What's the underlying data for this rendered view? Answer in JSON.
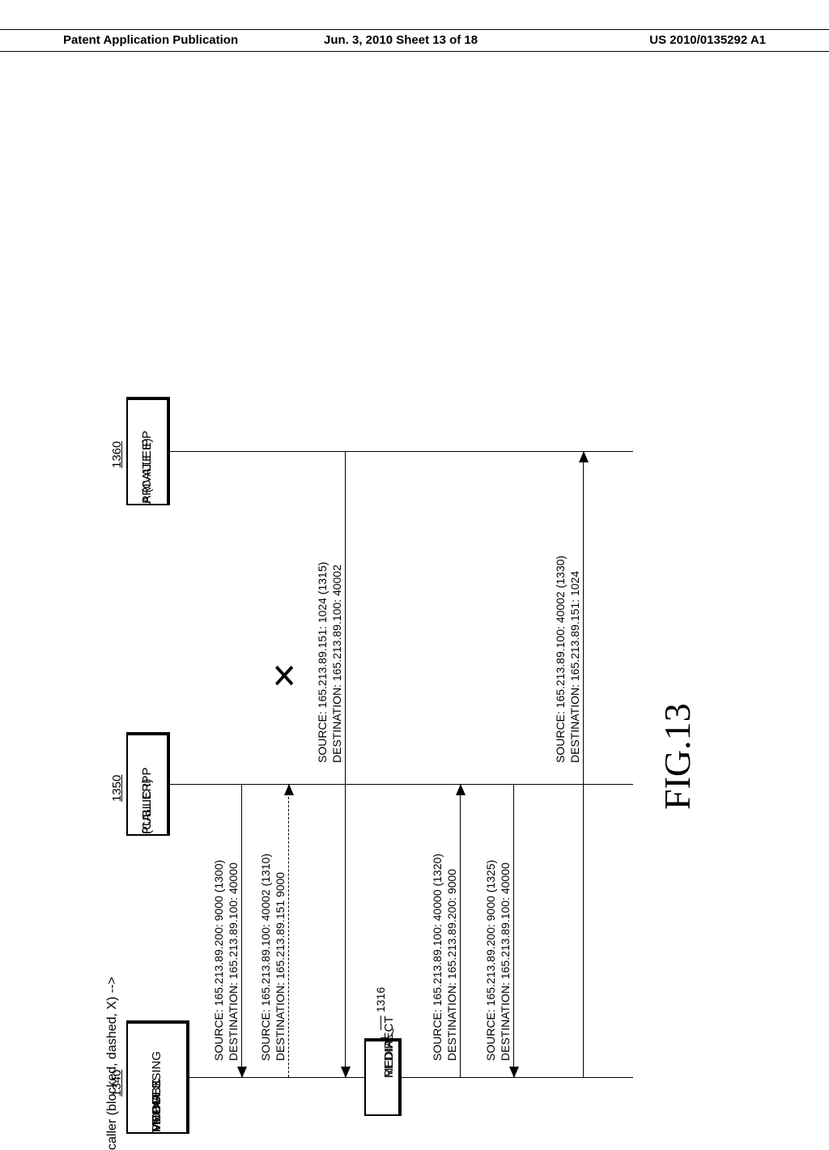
{
  "header": {
    "left": "Patent Application Publication",
    "center": "Jun. 3, 2010  Sheet 13 of 18",
    "right": "US 2010/0135292 A1"
  },
  "figure_label": "FIG.13",
  "actors": {
    "pbx": {
      "num": "1340",
      "line1": "VoIP PBX",
      "line2": "MEDIA",
      "line3": "PROCESSING",
      "line4": "MODULE"
    },
    "caller": {
      "num": "1350",
      "line1": "PUBLIC IPP",
      "line2": "(CALLER)"
    },
    "callee": {
      "num": "1360",
      "line1": "PRIVATE IPP",
      "line2": "A (CALLEE)"
    }
  },
  "media_redirect": {
    "num": "1316",
    "line1": "MEDIA",
    "line2": "REDIRECT"
  },
  "msgs": {
    "m1300": {
      "src": "SOURCE: 165.213.89.200: 9000 (1300)",
      "dst": "DESTINATION: 165.213.89.100: 40000"
    },
    "m1310": {
      "src": "SOURCE: 165.213.89.100: 40002 (1310)",
      "dst": "DESTINATION: 165.213.89.151 9000"
    },
    "m1315": {
      "src": "SOURCE: 165.213.89.151: 1024 (1315)",
      "dst": "DESTINATION: 165.213.89.100: 40002"
    },
    "m1320": {
      "src": "SOURCE: 165.213.89.100: 40000 (1320)",
      "dst": "DESTINATION: 165.213.89.200: 9000"
    },
    "m1325": {
      "src": "SOURCE: 165.213.89.200: 9000 (1325)",
      "dst": "DESTINATION: 165.213.89.100: 40000"
    },
    "m1330": {
      "src": "SOURCE: 165.213.89.100: 40002 (1330)",
      "dst": "DESTINATION: 165.213.89.151: 1024"
    }
  }
}
